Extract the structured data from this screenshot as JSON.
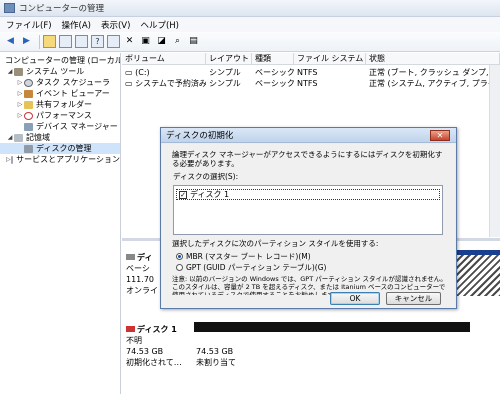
{
  "window": {
    "title": "コンピューターの管理"
  },
  "menu": [
    "ファイル(F)",
    "操作(A)",
    "表示(V)",
    "ヘルプ(H)"
  ],
  "toolbar": [
    "back-arrow-icon",
    "forward-arrow-icon",
    "up-folder-icon",
    "console-tree-icon",
    "list-view-icon",
    "help-icon",
    "properties-icon",
    "delete-icon",
    "export-icon",
    "connect-icon",
    "search-icon",
    "settings-icon"
  ],
  "tree": {
    "items": [
      {
        "label": "コンピューターの管理 (ローカル)",
        "level": 0,
        "exp": ""
      },
      {
        "label": "システム ツール",
        "level": 1,
        "exp": "◢"
      },
      {
        "label": "タスク スケジューラ",
        "level": 2,
        "exp": "▷"
      },
      {
        "label": "イベント ビューアー",
        "level": 2,
        "exp": "▷"
      },
      {
        "label": "共有フォルダー",
        "level": 2,
        "exp": "▷"
      },
      {
        "label": "パフォーマンス",
        "level": 2,
        "exp": "▷"
      },
      {
        "label": "デバイス マネージャー",
        "level": 2,
        "exp": ""
      },
      {
        "label": "記憶域",
        "level": 1,
        "exp": "◢"
      },
      {
        "label": "ディスクの管理",
        "level": 2,
        "exp": ""
      },
      {
        "label": "サービスとアプリケーション",
        "level": 1,
        "exp": "▷"
      }
    ]
  },
  "volumes": {
    "headers": [
      "ボリューム",
      "レイアウト",
      "種類",
      "ファイル システム",
      "状態"
    ],
    "rows": [
      [
        "(C:)",
        "シンプル",
        "ベーシック",
        "NTFS",
        "正常 (ブート, クラッシュ ダンプ, プライ"
      ],
      [
        "システムで予約済み",
        "シンプル",
        "ベーシック",
        "NTFS",
        "正常 (システム, アクティブ, プライマリ"
      ]
    ]
  },
  "disk0": {
    "name": "ディ",
    "type": "ベーシ",
    "size": "111.70",
    "status": "オンライ"
  },
  "disk1": {
    "name": "ディスク 1",
    "type": "不明",
    "size": "74.53 GB",
    "status": "初期化されて…",
    "part_size": "74.53 GB",
    "part_status": "未割り当て"
  },
  "dialog": {
    "title": "ディスクの初期化",
    "close": "✕",
    "intro": "論理ディスク マネージャーがアクセスできるようにするにはディスクを初期化する必要があります。",
    "select_label": "ディスクの選択(S):",
    "disk_item": "ディスク 1",
    "style_label": "選択したディスクに次のパーティション スタイルを使用する:",
    "mbr": "MBR (マスター ブート レコード)(M)",
    "gpt": "GPT (GUID パーティション テーブル)(G)",
    "note": "注意: 以前のバージョンの Windows では、GPT パーティション スタイルが認識されません。このスタイルは、容量が 2 TB を超えるディスク、または Itanium ベースのコンピューターで使用されているディスクで使用することをお勧めします。",
    "ok": "OK",
    "cancel": "キャンセル"
  },
  "colors": {
    "accent": "#3c7fb1",
    "selection": "#cfe3fb",
    "unallocated": "#111111"
  }
}
